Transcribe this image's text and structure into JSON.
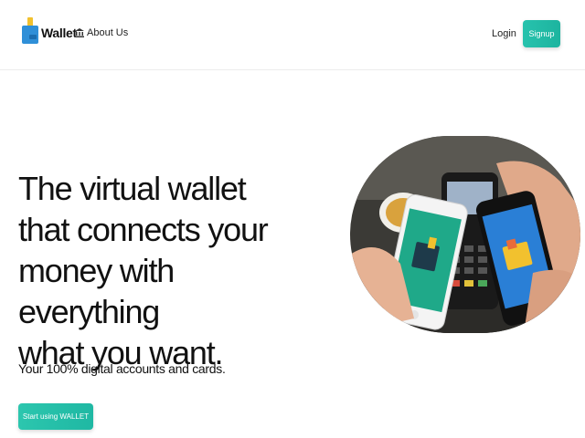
{
  "header": {
    "brand": "Wallet",
    "logo_icon": "wallet-card-icon",
    "about_label": "About Us",
    "about_icon": "bank-icon",
    "login_label": "Login",
    "signup_label": "Signup"
  },
  "hero": {
    "headline": "The virtual wallet\nthat connects your\nmoney with everything\nwhat you want.",
    "subtitle": "Your 100% digital accounts and cards.",
    "cta_label": "Start using WALLET",
    "image": "hands-holding-phones-payment-terminal"
  },
  "colors": {
    "accent": "#1fb8a3",
    "logo_blue": "#2f8fd8",
    "logo_yellow": "#f2c12e"
  }
}
